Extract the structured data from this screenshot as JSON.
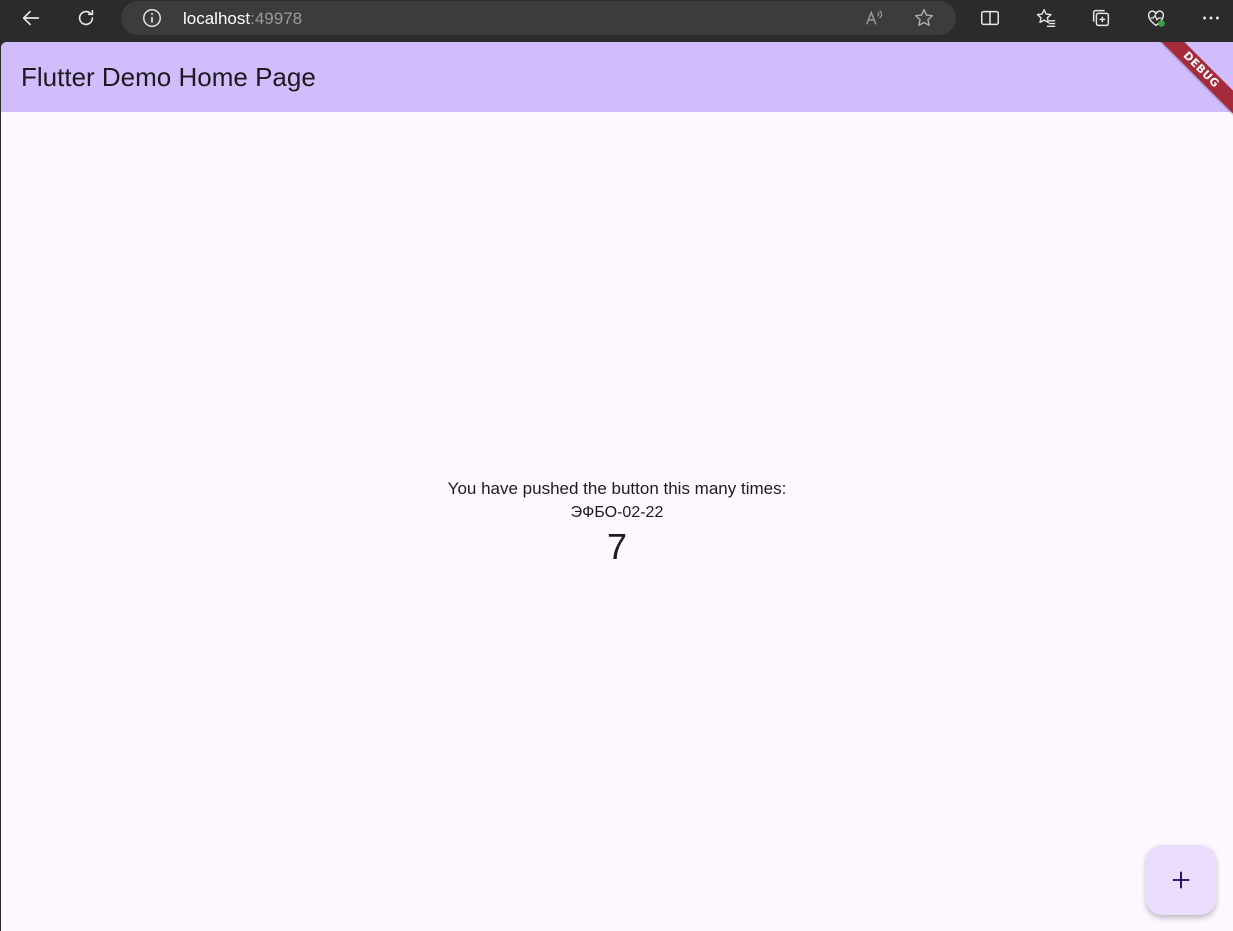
{
  "browser": {
    "url_host": "localhost",
    "url_port": ":49978",
    "icons": [
      "back-arrow-icon",
      "refresh-icon",
      "site-info-icon",
      "read-aloud-icon",
      "favorite-star-icon",
      "split-screen-icon",
      "favorites-icon",
      "collections-icon",
      "browser-essentials-icon",
      "more-menu-icon"
    ]
  },
  "appbar": {
    "title": "Flutter Demo Home Page",
    "debug_banner": "DEBUG",
    "color": "#d1bcfc"
  },
  "body": {
    "message": "You have pushed the button this many times:",
    "code": "ЭФБО-02-22",
    "counter": "7"
  },
  "fab": {
    "icon": "plus-icon",
    "color": "#ebddff"
  }
}
